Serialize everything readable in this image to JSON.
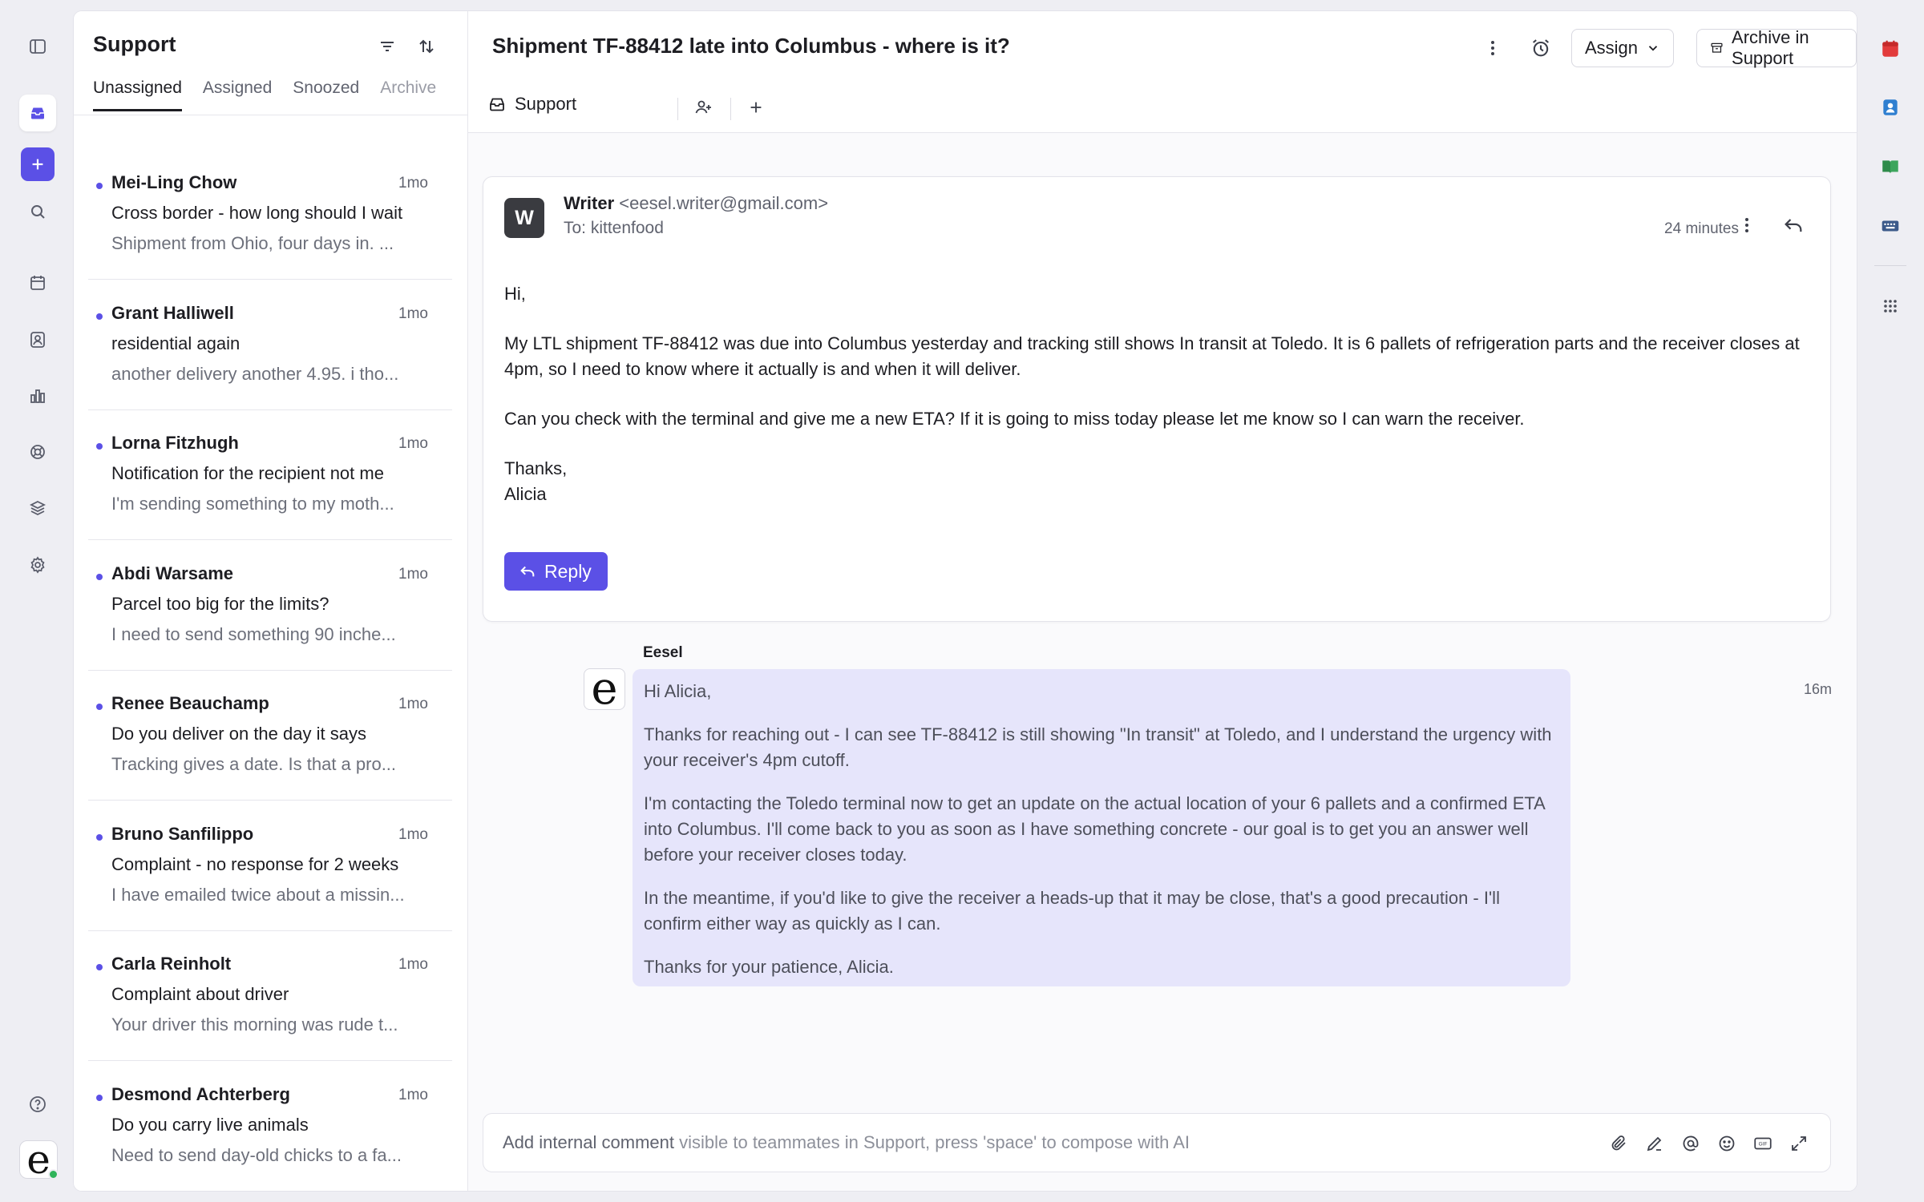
{
  "inbox": {
    "title": "Support",
    "tabs": [
      "Unassigned",
      "Assigned",
      "Snoozed",
      "Archive"
    ],
    "conversations": [
      {
        "name": "Mei-Ling Chow",
        "time": "1mo",
        "subject": "Cross border - how long should I wait",
        "preview": "Shipment from Ohio, four days in. ..."
      },
      {
        "name": "Grant Halliwell",
        "time": "1mo",
        "subject": "residential again",
        "preview": "another delivery another 4.95. i tho..."
      },
      {
        "name": "Lorna Fitzhugh",
        "time": "1mo",
        "subject": "Notification for the recipient not me",
        "preview": "I'm sending something to my moth..."
      },
      {
        "name": "Abdi Warsame",
        "time": "1mo",
        "subject": "Parcel too big for the limits?",
        "preview": "I need to send something 90 inche..."
      },
      {
        "name": "Renee Beauchamp",
        "time": "1mo",
        "subject": "Do you deliver on the day it says",
        "preview": "Tracking gives a date. Is that a pro..."
      },
      {
        "name": "Bruno Sanfilippo",
        "time": "1mo",
        "subject": "Complaint - no response for 2 weeks",
        "preview": "I have emailed twice about a missin..."
      },
      {
        "name": "Carla Reinholt",
        "time": "1mo",
        "subject": "Complaint about driver",
        "preview": "Your driver this morning was rude t..."
      },
      {
        "name": "Desmond Achterberg",
        "time": "1mo",
        "subject": "Do you carry live animals",
        "preview": "Need to send day-old chicks to a fa..."
      }
    ]
  },
  "ticket": {
    "title": "Shipment TF-88412 late into Columbus - where is it?",
    "assign_label": "Assign",
    "archive_label": "Archive in Support",
    "inbox_chip": "Support"
  },
  "email": {
    "avatar_letter": "W",
    "sender_name": "Writer",
    "sender_email": "<eesel.writer@gmail.com>",
    "to": "To: kittenfood",
    "time": "24 minutes",
    "greeting": "Hi,",
    "paragraph1": "My LTL shipment TF-88412 was due into Columbus yesterday and tracking still shows In transit at Toledo. It is 6 pallets of refrigeration parts and the receiver closes at 4pm, so I need to know where it actually is and when it will deliver.",
    "paragraph2": "Can you check with the terminal and give me a new ETA? If it is going to miss today please let me know so I can warn the receiver.",
    "signoff": "Thanks,",
    "signature": "Alicia",
    "reply_label": "Reply"
  },
  "ai_reply": {
    "author": "Eesel",
    "avatar_letter": "e",
    "time": "16m",
    "p1": "Hi Alicia,",
    "p2": "Thanks for reaching out - I can see TF-88412 is still showing \"In transit\" at Toledo, and I understand the urgency with your receiver's 4pm cutoff.",
    "p3": "I'm contacting the Toledo terminal now to get an update on the actual location of your 6 pallets and a confirmed ETA into Columbus. I'll come back to you as soon as I have something concrete - our goal is to get you an answer well before your receiver closes today.",
    "p4": "In the meantime, if you'd like to give the receiver a heads-up that it may be close, that's a good precaution - I'll confirm either way as quickly as I can.",
    "p5": "Thanks for your patience, Alicia."
  },
  "composer": {
    "placeholder_bold": "Add internal comment",
    "placeholder_rest": " visible to teammates in Support, press 'space' to compose with AI"
  },
  "logo_letter": "e",
  "colors": {
    "accent": "#5b50e6",
    "ai_bubble": "#e6e5fb",
    "online": "#2fb45a"
  },
  "icons": {
    "left_rail": [
      "sidebar-toggle-icon",
      "inbox-icon",
      "plus-icon",
      "search-icon",
      "calendar-icon",
      "contact-icon",
      "chart-icon",
      "lifebuoy-icon",
      "layers-icon",
      "gear-icon",
      "help-icon"
    ],
    "right_rail": [
      "calendar-app-icon",
      "contacts-app-icon",
      "book-app-icon",
      "keyboard-app-icon",
      "apps-grid-icon"
    ]
  }
}
